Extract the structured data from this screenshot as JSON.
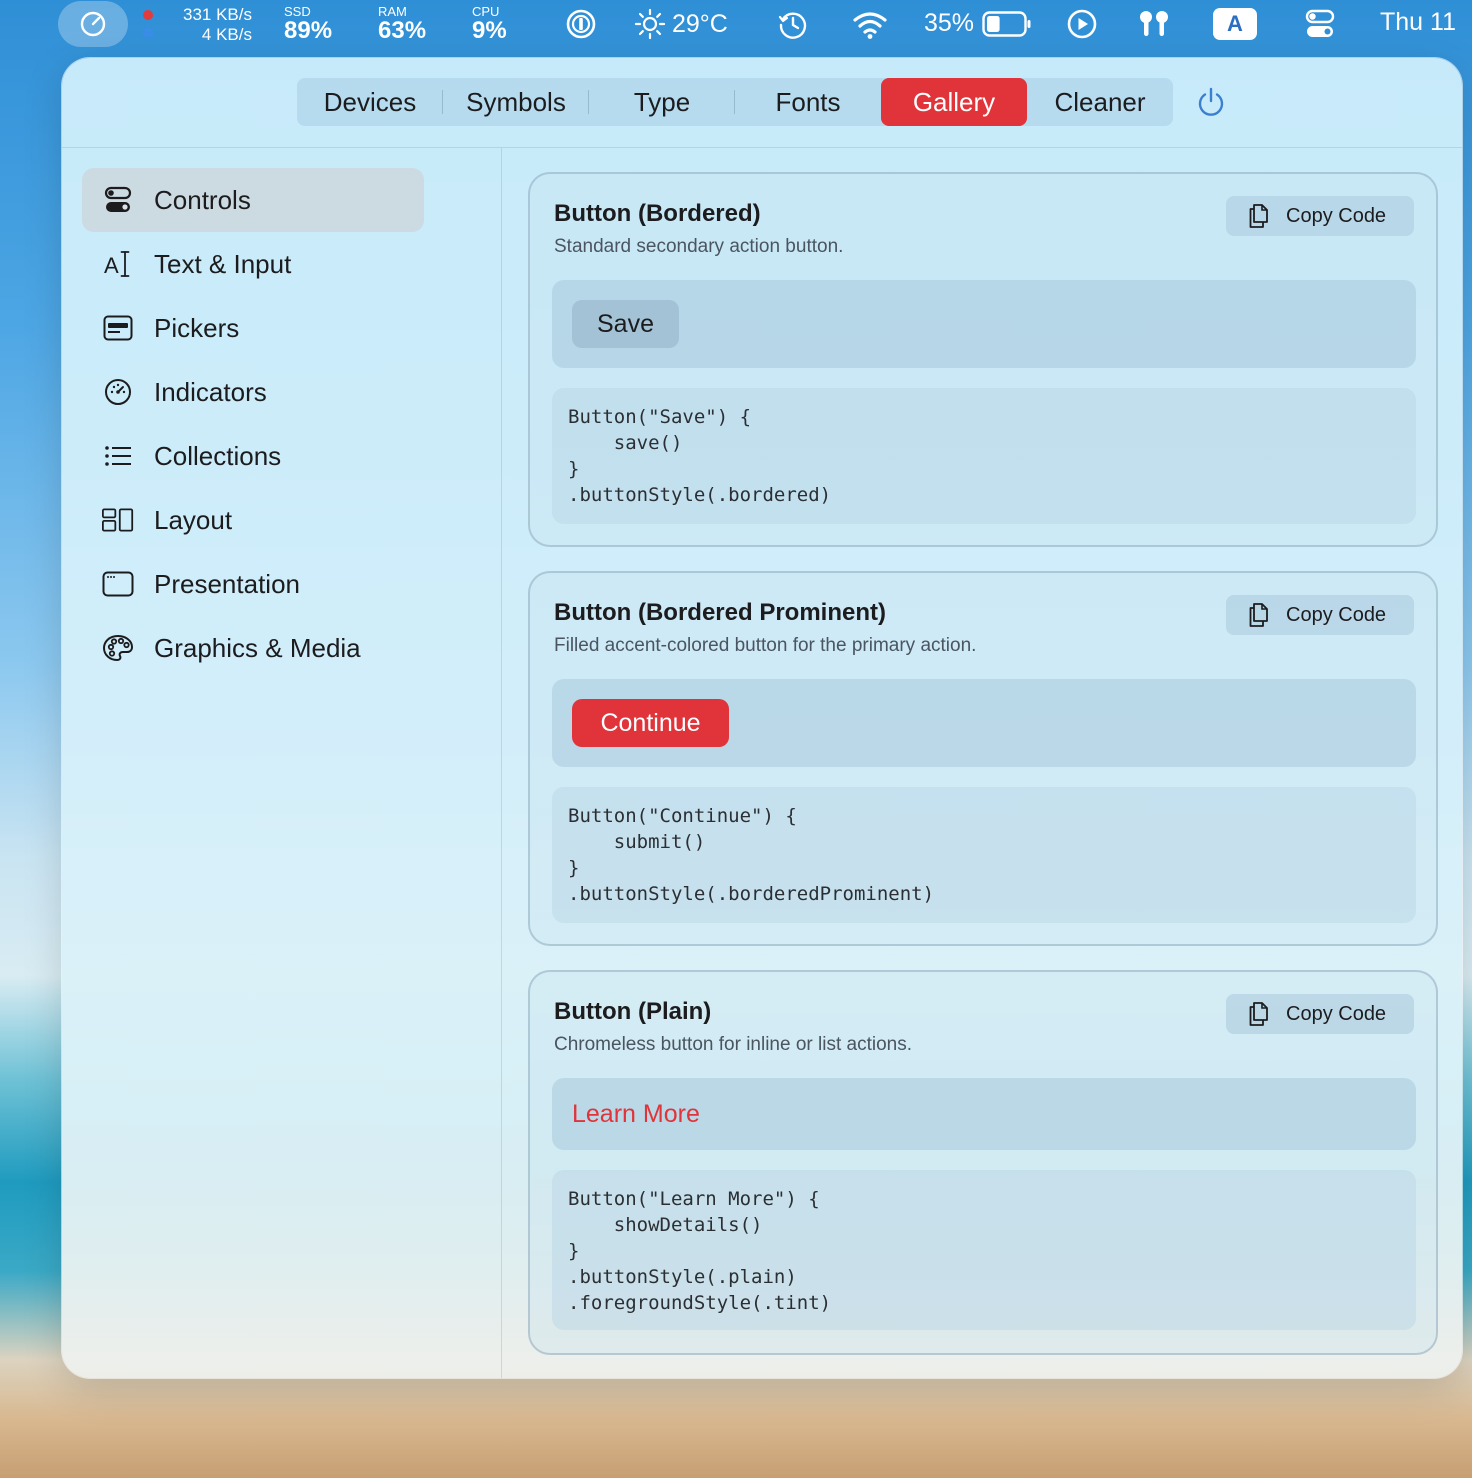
{
  "menubar": {
    "network_up": "331 KB/s",
    "network_down": "4 KB/s",
    "ssd_label": "SSD",
    "ssd_value": "89%",
    "ram_label": "RAM",
    "ram_value": "63%",
    "cpu_label": "CPU",
    "cpu_value": "9%",
    "weather": "29°C",
    "battery": "35%",
    "battery_level": 0.35,
    "input_source": "A",
    "clock": "Thu 11"
  },
  "tabs": [
    {
      "label": "Devices",
      "active": false
    },
    {
      "label": "Symbols",
      "active": false
    },
    {
      "label": "Type",
      "active": false
    },
    {
      "label": "Fonts",
      "active": false
    },
    {
      "label": "Gallery",
      "active": true
    },
    {
      "label": "Cleaner",
      "active": false
    }
  ],
  "sidebar": {
    "items": [
      {
        "label": "Controls",
        "icon": "toggles-icon",
        "active": true
      },
      {
        "label": "Text & Input",
        "icon": "text-cursor-icon",
        "active": false
      },
      {
        "label": "Pickers",
        "icon": "picker-icon",
        "active": false
      },
      {
        "label": "Indicators",
        "icon": "gauge-icon",
        "active": false
      },
      {
        "label": "Collections",
        "icon": "list-icon",
        "active": false
      },
      {
        "label": "Layout",
        "icon": "layout-icon",
        "active": false
      },
      {
        "label": "Presentation",
        "icon": "window-icon",
        "active": false
      },
      {
        "label": "Graphics & Media",
        "icon": "palette-icon",
        "active": false
      }
    ]
  },
  "copy_label": "Copy Code",
  "cards": [
    {
      "title": "Button (Bordered)",
      "description": "Standard secondary action button.",
      "demo_label": "Save",
      "code": [
        "Button(\"Save\") {",
        "    save()",
        "}",
        ".buttonStyle(.bordered)"
      ]
    },
    {
      "title": "Button (Bordered Prominent)",
      "description": "Filled accent-colored button for the primary action.",
      "demo_label": "Continue",
      "code": [
        "Button(\"Continue\") {",
        "    submit()",
        "}",
        ".buttonStyle(.borderedProminent)"
      ]
    },
    {
      "title": "Button (Plain)",
      "description": "Chromeless button for inline or list actions.",
      "demo_label": "Learn More",
      "code": [
        "Button(\"Learn More\") {",
        "    showDetails()",
        "}",
        ".buttonStyle(.plain)",
        ".foregroundStyle(.tint)"
      ]
    }
  ],
  "colors": {
    "accent": "#e0343a",
    "text": "#1c1c1e",
    "secondary_text": "#4a5560"
  }
}
